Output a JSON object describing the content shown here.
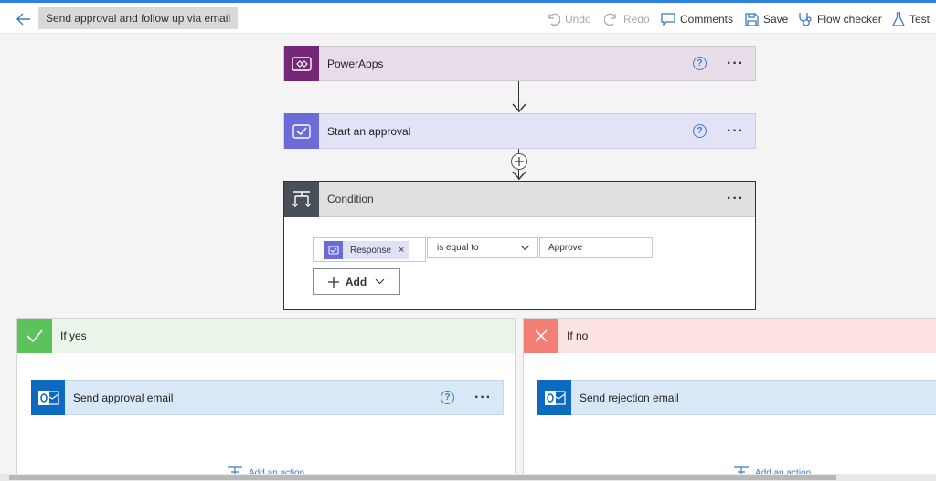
{
  "header": {
    "title": "Send approval and follow up via email",
    "undo": "Undo",
    "redo": "Redo",
    "comments": "Comments",
    "save": "Save",
    "flow_checker": "Flow checker",
    "test": "Test"
  },
  "nodes": {
    "powerapps": {
      "label": "PowerApps",
      "help": "?",
      "color": "#742774"
    },
    "approval": {
      "label": "Start an approval",
      "help": "?",
      "color": "#6c6cd9"
    },
    "condition": {
      "label": "Condition",
      "token": "Response",
      "token_remove": "×",
      "operator": "is equal to",
      "value": "Approve",
      "add_label": "Add"
    }
  },
  "branches": {
    "yes": {
      "label": "If yes",
      "action": "Send approval email",
      "help": "?",
      "add_action": "Add an action",
      "color": "#5cc35c"
    },
    "no": {
      "label": "If no",
      "action": "Send rejection email",
      "add_action": "Add an action",
      "color": "#f27e74"
    }
  },
  "icons": {
    "back": "arrow-left-icon",
    "undo": "undo-icon",
    "redo": "redo-icon",
    "comments": "comment-icon",
    "save": "save-icon",
    "flow_checker": "stethoscope-icon",
    "test": "flask-icon"
  }
}
